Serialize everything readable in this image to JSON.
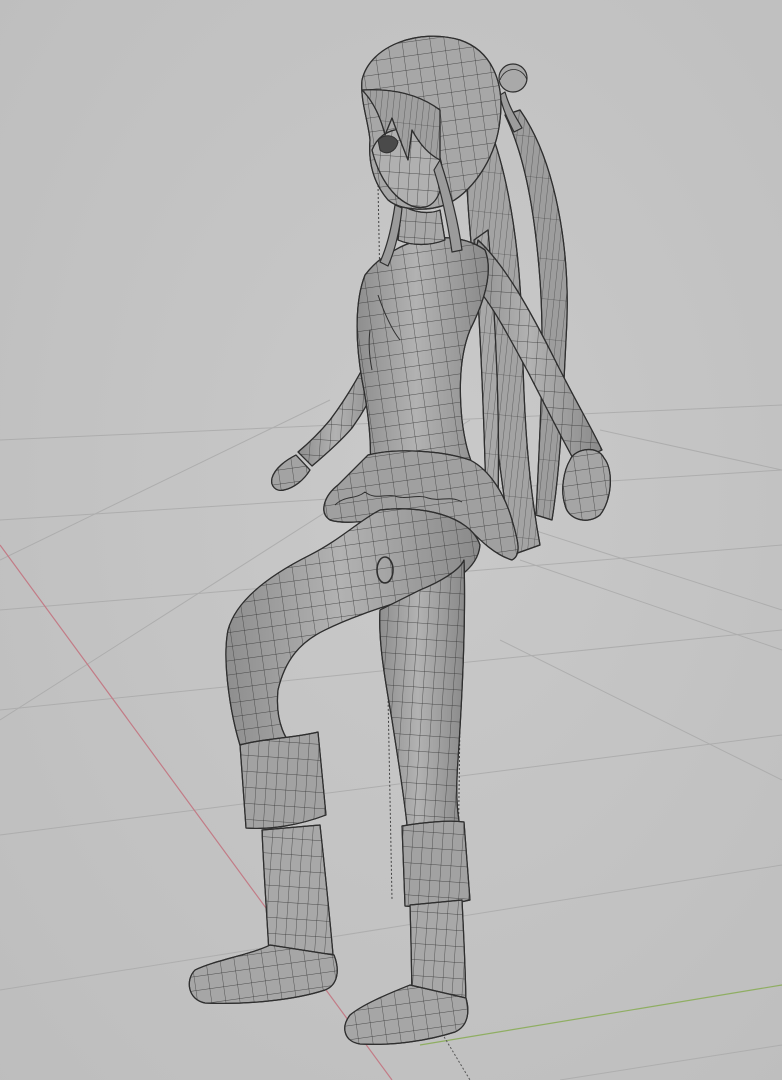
{
  "scene": {
    "colors": {
      "background": "#c0c0c0",
      "background_light": "#c9c9c9",
      "grid_line": "#aaaaaa",
      "x_axis": "#c27b86",
      "y_axis": "#8fae62",
      "model_fill": "#9e9e9e",
      "model_shadow": "#838383",
      "model_highlight": "#b4b4b4",
      "wireframe": "#2f2f2f"
    },
    "model": "anime-girl-wireframe-mesh"
  }
}
